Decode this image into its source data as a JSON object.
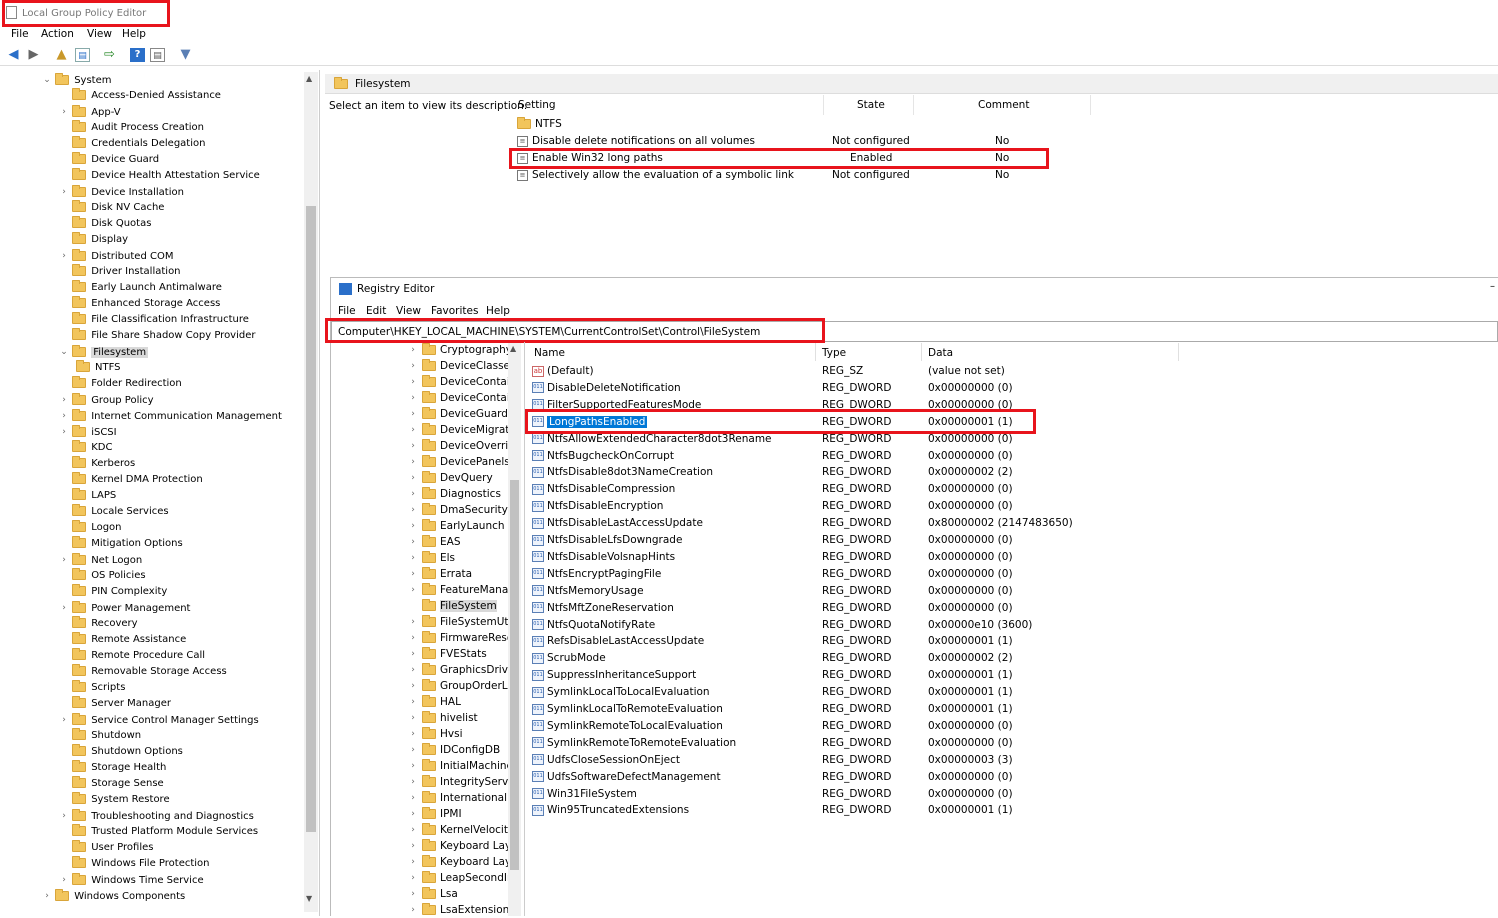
{
  "window": {
    "title": "Local Group Policy Editor"
  },
  "menu": [
    "File",
    "Action",
    "View",
    "Help"
  ],
  "toolbar_icons": [
    "back-icon",
    "forward-icon",
    "up-folder-icon",
    "show-hide-tree-icon",
    "export-list-icon",
    "help-icon",
    "properties-icon",
    "filter-icon"
  ],
  "tree": {
    "root": "System",
    "items": [
      {
        "label": "Access-Denied Assistance",
        "expandable": false
      },
      {
        "label": "App-V",
        "expandable": true
      },
      {
        "label": "Audit Process Creation",
        "expandable": false
      },
      {
        "label": "Credentials Delegation",
        "expandable": false
      },
      {
        "label": "Device Guard",
        "expandable": false
      },
      {
        "label": "Device Health Attestation Service",
        "expandable": false
      },
      {
        "label": "Device Installation",
        "expandable": true
      },
      {
        "label": "Disk NV Cache",
        "expandable": false
      },
      {
        "label": "Disk Quotas",
        "expandable": false
      },
      {
        "label": "Display",
        "expandable": false
      },
      {
        "label": "Distributed COM",
        "expandable": true
      },
      {
        "label": "Driver Installation",
        "expandable": false
      },
      {
        "label": "Early Launch Antimalware",
        "expandable": false
      },
      {
        "label": "Enhanced Storage Access",
        "expandable": false
      },
      {
        "label": "File Classification Infrastructure",
        "expandable": false
      },
      {
        "label": "File Share Shadow Copy Provider",
        "expandable": false
      },
      {
        "label": "Filesystem",
        "expandable": true,
        "expanded": true,
        "selected": true
      },
      {
        "label": "NTFS",
        "expandable": false,
        "child": true
      },
      {
        "label": "Folder Redirection",
        "expandable": false
      },
      {
        "label": "Group Policy",
        "expandable": true
      },
      {
        "label": "Internet Communication Management",
        "expandable": true
      },
      {
        "label": "iSCSI",
        "expandable": true
      },
      {
        "label": "KDC",
        "expandable": false
      },
      {
        "label": "Kerberos",
        "expandable": false
      },
      {
        "label": "Kernel DMA Protection",
        "expandable": false
      },
      {
        "label": "LAPS",
        "expandable": false
      },
      {
        "label": "Locale Services",
        "expandable": false
      },
      {
        "label": "Logon",
        "expandable": false
      },
      {
        "label": "Mitigation Options",
        "expandable": false
      },
      {
        "label": "Net Logon",
        "expandable": true
      },
      {
        "label": "OS Policies",
        "expandable": false
      },
      {
        "label": "PIN Complexity",
        "expandable": false
      },
      {
        "label": "Power Management",
        "expandable": true
      },
      {
        "label": "Recovery",
        "expandable": false
      },
      {
        "label": "Remote Assistance",
        "expandable": false
      },
      {
        "label": "Remote Procedure Call",
        "expandable": false
      },
      {
        "label": "Removable Storage Access",
        "expandable": false
      },
      {
        "label": "Scripts",
        "expandable": false
      },
      {
        "label": "Server Manager",
        "expandable": false
      },
      {
        "label": "Service Control Manager Settings",
        "expandable": true
      },
      {
        "label": "Shutdown",
        "expandable": false
      },
      {
        "label": "Shutdown Options",
        "expandable": false
      },
      {
        "label": "Storage Health",
        "expandable": false
      },
      {
        "label": "Storage Sense",
        "expandable": false
      },
      {
        "label": "System Restore",
        "expandable": false
      },
      {
        "label": "Troubleshooting and Diagnostics",
        "expandable": true
      },
      {
        "label": "Trusted Platform Module Services",
        "expandable": false
      },
      {
        "label": "User Profiles",
        "expandable": false
      },
      {
        "label": "Windows File Protection",
        "expandable": false
      },
      {
        "label": "Windows Time Service",
        "expandable": true
      }
    ],
    "next_root": "Windows Components"
  },
  "policy_pane": {
    "header": "Filesystem",
    "description": "Select an item to view its description.",
    "columns": [
      "Setting",
      "State",
      "Comment"
    ],
    "folder": "NTFS",
    "settings": [
      {
        "name": "Disable delete notifications on all volumes",
        "state": "Not configured",
        "comment": "No"
      },
      {
        "name": "Enable Win32 long paths",
        "state": "Enabled",
        "comment": "No"
      },
      {
        "name": "Selectively allow the evaluation of a symbolic link",
        "state": "Not configured",
        "comment": "No"
      }
    ]
  },
  "registry": {
    "title": "Registry Editor",
    "menu": [
      "File",
      "Edit",
      "View",
      "Favorites",
      "Help"
    ],
    "address": "Computer\\HKEY_LOCAL_MACHINE\\SYSTEM\\CurrentControlSet\\Control\\FileSystem",
    "keys": [
      "Cryptography",
      "DeviceClasses",
      "DeviceContair",
      "DeviceContair",
      "DeviceGuard",
      "DeviceMigratii",
      "DeviceOverrid",
      "DevicePanels",
      "DevQuery",
      "Diagnostics",
      "DmaSecurity",
      "EarlyLaunch",
      "EAS",
      "Els",
      "Errata",
      "FeatureManag",
      "FileSystem",
      "FileSystemUtil",
      "FirmwareReso",
      "FVEStats",
      "GraphicsDriver",
      "GroupOrderLis",
      "HAL",
      "hivelist",
      "Hvsi",
      "IDConfigDB",
      "InitialMachine",
      "IntegrityServic",
      "International",
      "IPMI",
      "KernelVelocity",
      "Keyboard Layc",
      "Keyboard Layc",
      "LeapSecondIn",
      "Lsa",
      "LsaExtensionC"
    ],
    "selected_key": "FileSystem",
    "columns": [
      "Name",
      "Type",
      "Data"
    ],
    "values": [
      {
        "name": "(Default)",
        "type": "REG_SZ",
        "data": "(value not set)",
        "icon": "string-value-icon"
      },
      {
        "name": "DisableDeleteNotification",
        "type": "REG_DWORD",
        "data": "0x00000000 (0)"
      },
      {
        "name": "FilterSupportedFeaturesMode",
        "type": "REG_DWORD",
        "data": "0x00000000 (0)"
      },
      {
        "name": "LongPathsEnabled",
        "type": "REG_DWORD",
        "data": "0x00000001 (1)",
        "selected": true
      },
      {
        "name": "NtfsAllowExtendedCharacter8dot3Rename",
        "type": "REG_DWORD",
        "data": "0x00000000 (0)"
      },
      {
        "name": "NtfsBugcheckOnCorrupt",
        "type": "REG_DWORD",
        "data": "0x00000000 (0)"
      },
      {
        "name": "NtfsDisable8dot3NameCreation",
        "type": "REG_DWORD",
        "data": "0x00000002 (2)"
      },
      {
        "name": "NtfsDisableCompression",
        "type": "REG_DWORD",
        "data": "0x00000000 (0)"
      },
      {
        "name": "NtfsDisableEncryption",
        "type": "REG_DWORD",
        "data": "0x00000000 (0)"
      },
      {
        "name": "NtfsDisableLastAccessUpdate",
        "type": "REG_DWORD",
        "data": "0x80000002 (2147483650)"
      },
      {
        "name": "NtfsDisableLfsDowngrade",
        "type": "REG_DWORD",
        "data": "0x00000000 (0)"
      },
      {
        "name": "NtfsDisableVolsnapHints",
        "type": "REG_DWORD",
        "data": "0x00000000 (0)"
      },
      {
        "name": "NtfsEncryptPagingFile",
        "type": "REG_DWORD",
        "data": "0x00000000 (0)"
      },
      {
        "name": "NtfsMemoryUsage",
        "type": "REG_DWORD",
        "data": "0x00000000 (0)"
      },
      {
        "name": "NtfsMftZoneReservation",
        "type": "REG_DWORD",
        "data": "0x00000000 (0)"
      },
      {
        "name": "NtfsQuotaNotifyRate",
        "type": "REG_DWORD",
        "data": "0x00000e10 (3600)"
      },
      {
        "name": "RefsDisableLastAccessUpdate",
        "type": "REG_DWORD",
        "data": "0x00000001 (1)"
      },
      {
        "name": "ScrubMode",
        "type": "REG_DWORD",
        "data": "0x00000002 (2)"
      },
      {
        "name": "SuppressInheritanceSupport",
        "type": "REG_DWORD",
        "data": "0x00000001 (1)"
      },
      {
        "name": "SymlinkLocalToLocalEvaluation",
        "type": "REG_DWORD",
        "data": "0x00000001 (1)"
      },
      {
        "name": "SymlinkLocalToRemoteEvaluation",
        "type": "REG_DWORD",
        "data": "0x00000001 (1)"
      },
      {
        "name": "SymlinkRemoteToLocalEvaluation",
        "type": "REG_DWORD",
        "data": "0x00000000 (0)"
      },
      {
        "name": "SymlinkRemoteToRemoteEvaluation",
        "type": "REG_DWORD",
        "data": "0x00000000 (0)"
      },
      {
        "name": "UdfsCloseSessionOnEject",
        "type": "REG_DWORD",
        "data": "0x00000003 (3)"
      },
      {
        "name": "UdfsSoftwareDefectManagement",
        "type": "REG_DWORD",
        "data": "0x00000000 (0)"
      },
      {
        "name": "Win31FileSystem",
        "type": "REG_DWORD",
        "data": "0x00000000 (0)"
      },
      {
        "name": "Win95TruncatedExtensions",
        "type": "REG_DWORD",
        "data": "0x00000001 (1)"
      }
    ]
  },
  "colors": {
    "highlight_box": "#e8141c",
    "selection": "#0078d7",
    "folder": "#f2c55c"
  }
}
